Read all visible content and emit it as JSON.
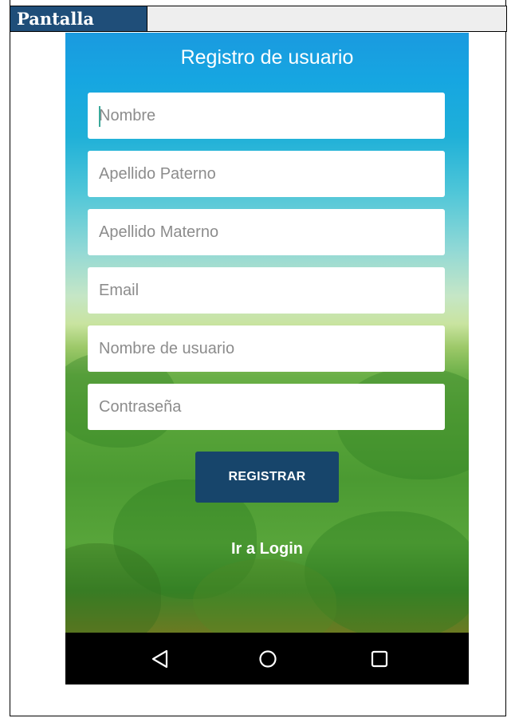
{
  "doc": {
    "header_label": "Pantalla"
  },
  "app": {
    "title": "Registro de usuario",
    "fields": [
      {
        "placeholder": "Nombre"
      },
      {
        "placeholder": "Apellido Paterno"
      },
      {
        "placeholder": "Apellido Materno"
      },
      {
        "placeholder": "Email"
      },
      {
        "placeholder": "Nombre de usuario"
      },
      {
        "placeholder": "Contraseña"
      }
    ],
    "register_label": "REGISTRAR",
    "login_link": "Ir a Login"
  },
  "navbar": {
    "buttons": [
      "back-triangle-icon",
      "home-circle-icon",
      "recents-square-icon"
    ]
  },
  "colors": {
    "header_bg": "#1f4e79",
    "button_bg": "#17456b",
    "caret": "#3aa89a"
  }
}
